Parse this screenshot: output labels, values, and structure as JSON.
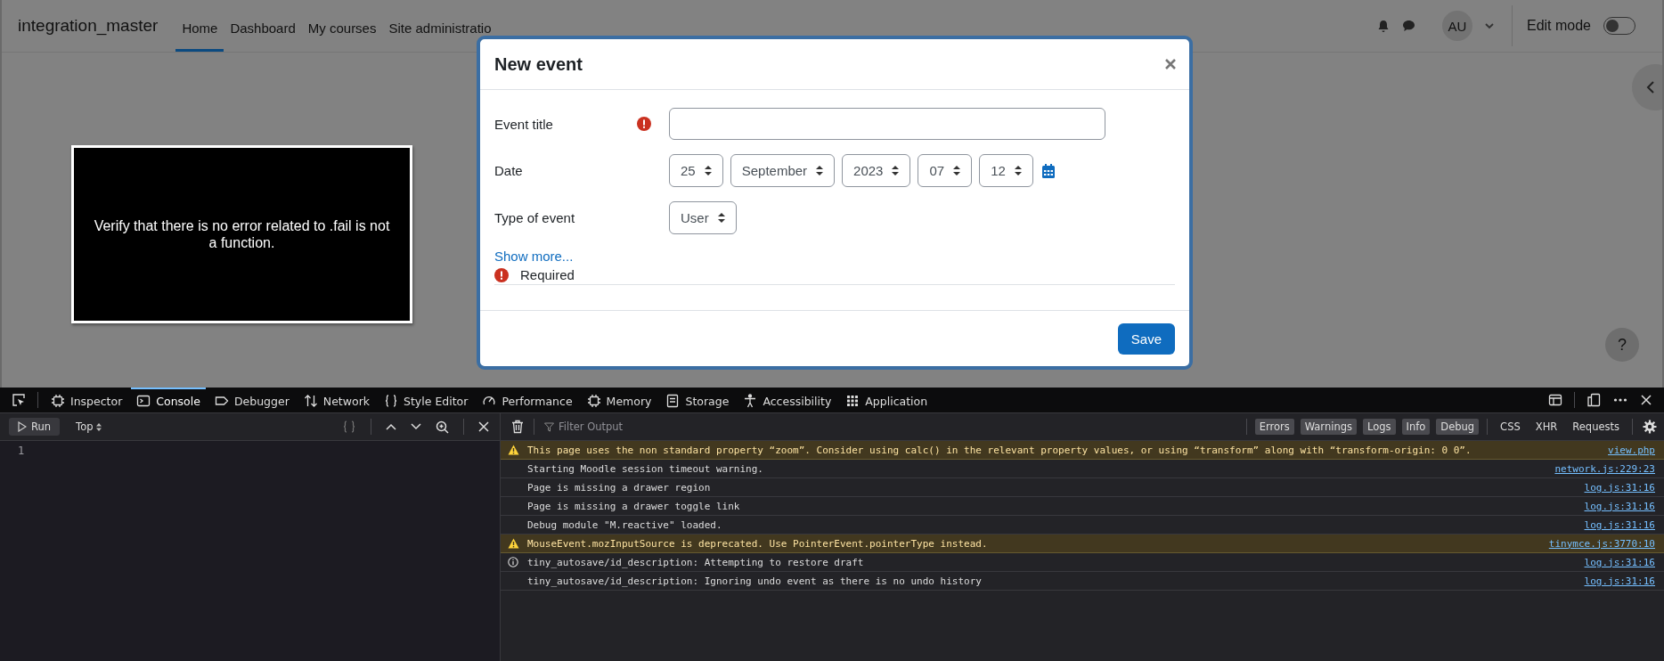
{
  "navbar": {
    "site_name": "integration_master",
    "links": [
      {
        "label": "Home",
        "selected": true
      },
      {
        "label": "Dashboard",
        "selected": false
      },
      {
        "label": "My courses",
        "selected": false
      },
      {
        "label": "Site administratio",
        "selected": false
      }
    ],
    "avatar_initials": "AU",
    "edit_mode": {
      "label": "Edit mode",
      "on": false
    }
  },
  "video": {
    "caption": "Verify that there is no error related to .fail is not a function."
  },
  "help_button": "?",
  "modal": {
    "title": "New event",
    "fields": [
      {
        "kind": "text",
        "label": "Event title",
        "required": true
      },
      {
        "kind": "date",
        "label": "Date",
        "required": false,
        "selects": [
          "25",
          "September",
          "2023",
          "07",
          "12"
        ]
      },
      {
        "kind": "select",
        "label": "Type of event",
        "required": false,
        "selects": [
          "User"
        ]
      }
    ],
    "show_more": "Show more...",
    "required_note": "Required",
    "save": "Save"
  },
  "devtools": {
    "tabs": [
      {
        "label": "Inspector",
        "selected": false
      },
      {
        "label": "Console",
        "selected": true
      },
      {
        "label": "Debugger",
        "selected": false
      },
      {
        "label": "Network",
        "selected": false
      },
      {
        "label": "Style Editor",
        "selected": false
      },
      {
        "label": "Performance",
        "selected": false
      },
      {
        "label": "Memory",
        "selected": false
      },
      {
        "label": "Storage",
        "selected": false
      },
      {
        "label": "Accessibility",
        "selected": false
      },
      {
        "label": "Application",
        "selected": false
      }
    ],
    "editor": {
      "run": "Run",
      "context": "Top",
      "line_numbers": [
        "1"
      ]
    },
    "filter_placeholder": "Filter Output",
    "level_filters": [
      {
        "label": "Errors",
        "selected": true
      },
      {
        "label": "Warnings",
        "selected": true
      },
      {
        "label": "Logs",
        "selected": true
      },
      {
        "label": "Info",
        "selected": true
      },
      {
        "label": "Debug",
        "selected": true
      }
    ],
    "type_filters": [
      {
        "label": "CSS",
        "selected": false
      },
      {
        "label": "XHR",
        "selected": false
      },
      {
        "label": "Requests",
        "selected": false
      }
    ],
    "messages": [
      {
        "kind": "warning",
        "text": "This page uses the non standard property “zoom”. Consider using calc() in the relevant property values, or using “transform” along with “transform-origin: 0 0”.",
        "source": "view.php"
      },
      {
        "kind": "log",
        "text": "Starting Moodle session timeout warning.",
        "source": "network.js:229:23"
      },
      {
        "kind": "log",
        "text": "Page is missing a drawer region",
        "source": "log.js:31:16"
      },
      {
        "kind": "log",
        "text": "Page is missing a drawer toggle link",
        "source": "log.js:31:16"
      },
      {
        "kind": "log",
        "text": "Debug module \"M.reactive\" loaded.",
        "source": "log.js:31:16"
      },
      {
        "kind": "warning",
        "text": "MouseEvent.mozInputSource is deprecated. Use PointerEvent.pointerType instead.",
        "source": "tinymce.js:3770:10"
      },
      {
        "kind": "info",
        "text": "tiny_autosave/id_description: Attempting to restore draft",
        "source": "log.js:31:16"
      },
      {
        "kind": "log",
        "text": "tiny_autosave/id_description: Ignoring undo event as there is no undo history",
        "source": "log.js:31:16"
      }
    ]
  }
}
